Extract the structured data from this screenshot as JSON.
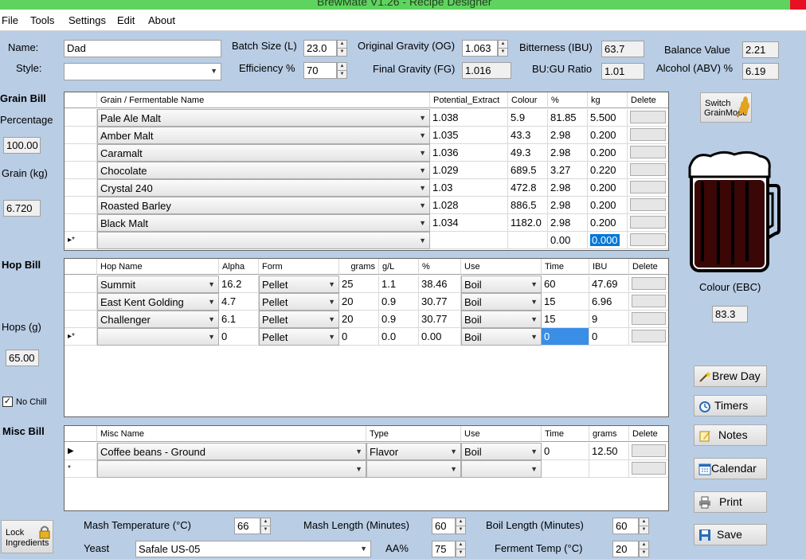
{
  "window": {
    "title": "BrewMate V1.26 - Recipe Designer"
  },
  "menu": [
    "File",
    "Tools",
    "Settings",
    "Edit",
    "About"
  ],
  "recipe": {
    "name_label": "Name:",
    "name": "Dad",
    "style_label": "Style:",
    "style": "",
    "batch_label": "Batch Size (L)",
    "batch": "23.0",
    "eff_label": "Efficiency %",
    "eff": "70",
    "og_label": "Original Gravity (OG)",
    "og": "1.063",
    "fg_label": "Final Gravity (FG)",
    "fg": "1.016",
    "ibu_label": "Bitterness (IBU)",
    "ibu": "63.7",
    "bugu_label": "BU:GU Ratio",
    "bugu": "1.01",
    "bal_label": "Balance Value",
    "bal": "2.21",
    "abv_label": "Alcohol (ABV) %",
    "abv": "6.19"
  },
  "grain": {
    "title": "Grain Bill",
    "pct_label": "Percentage",
    "pct": "100.00",
    "kg_label": "Grain (kg)",
    "kg": "6.720",
    "headers": [
      "Grain / Fermentable Name",
      "Potential_Extract",
      "Colour",
      "%",
      "kg",
      "Delete"
    ],
    "rows": [
      [
        "Pale Ale Malt",
        "1.038",
        "5.9",
        "81.85",
        "5.500"
      ],
      [
        "Amber Malt",
        "1.035",
        "43.3",
        "2.98",
        "0.200"
      ],
      [
        "Caramalt",
        "1.036",
        "49.3",
        "2.98",
        "0.200"
      ],
      [
        "Chocolate",
        "1.029",
        "689.5",
        "3.27",
        "0.220"
      ],
      [
        "Crystal 240",
        "1.03",
        "472.8",
        "2.98",
        "0.200"
      ],
      [
        "Roasted Barley",
        "1.028",
        "886.5",
        "2.98",
        "0.200"
      ],
      [
        "Black Malt",
        "1.034",
        "1182.0",
        "2.98",
        "0.200"
      ]
    ],
    "new_row": [
      "",
      "",
      "",
      "0.00",
      "0.000"
    ],
    "new_row_marker": "▸*"
  },
  "switch": {
    "label1": "Switch",
    "label2": "GrainMode"
  },
  "colour": {
    "label": "Colour (EBC)",
    "value": "83.3"
  },
  "hop": {
    "title": "Hop Bill",
    "g_label": "Hops (g)",
    "g": "65.00",
    "nochill": "No Chill",
    "headers": [
      "Hop Name",
      "Alpha",
      "Form",
      "grams",
      "g/L",
      "%",
      "Use",
      "Time",
      "IBU",
      "Delete"
    ],
    "rows": [
      [
        "Summit",
        "16.2",
        "Pellet",
        "25",
        "1.1",
        "38.46",
        "Boil",
        "60",
        "47.69"
      ],
      [
        "East Kent Golding",
        "4.7",
        "Pellet",
        "20",
        "0.9",
        "30.77",
        "Boil",
        "15",
        "6.96"
      ],
      [
        "Challenger",
        "6.1",
        "Pellet",
        "20",
        "0.9",
        "30.77",
        "Boil",
        "15",
        "9"
      ]
    ],
    "new_row": [
      "",
      "0",
      "Pellet",
      "0",
      "0.0",
      "0.00",
      "Boil",
      "0",
      "0"
    ],
    "new_row_marker": "▸*"
  },
  "misc": {
    "title": "Misc Bill",
    "headers": [
      "Misc Name",
      "Type",
      "Use",
      "Time",
      "grams",
      "Delete"
    ],
    "rows": [
      [
        "Coffee beans - Ground",
        "Flavor",
        "Boil",
        "0",
        "12.50"
      ]
    ],
    "row_marker": "▶",
    "new_row_marker": "*"
  },
  "buttons": {
    "brew": "Brew Day",
    "timers": "Timers",
    "notes": "Notes",
    "calendar": "Calendar",
    "print": "Print",
    "save": "Save"
  },
  "lock": {
    "line1": "Lock",
    "line2": "Ingredients"
  },
  "bottom": {
    "mash_t_label": "Mash Temperature (°C)",
    "mash_t": "66",
    "mash_l_label": "Mash Length (Minutes)",
    "mash_l": "60",
    "boil_l_label": "Boil Length (Minutes)",
    "boil_l": "60",
    "yeast_label": "Yeast",
    "yeast": "Safale US-05",
    "aa_label": "AA%",
    "aa": "75",
    "ferm_label": "Ferment Temp (°C)",
    "ferm": "20"
  }
}
